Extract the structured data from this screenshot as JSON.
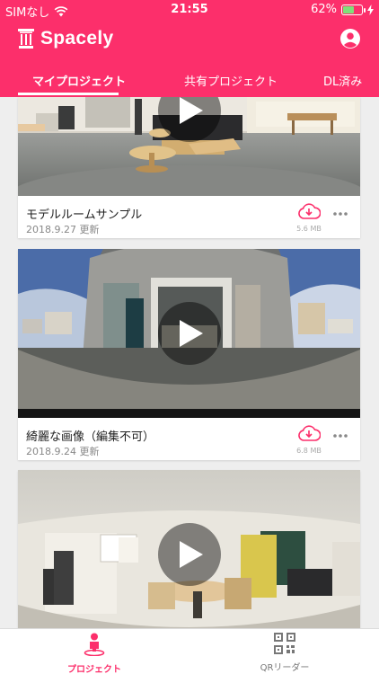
{
  "status_bar": {
    "carrier": "SIMなし",
    "time": "21:55",
    "battery": "62%",
    "battery_level": 0.62
  },
  "app": {
    "title": "Spacely"
  },
  "tabs": [
    {
      "label": "マイプロジェクト",
      "active": true
    },
    {
      "label": "共有プロジェクト",
      "active": false
    },
    {
      "label": "DL済み",
      "active": false
    }
  ],
  "projects": [
    {
      "title": "モデルルームサンプル",
      "date": "2018.9.27 更新",
      "size": "5.6 MB"
    },
    {
      "title": "綺麗な画像（編集不可）",
      "date": "2018.9.24 更新",
      "size": "6.8 MB"
    },
    {
      "title": "",
      "date": "",
      "size": ""
    }
  ],
  "bottom_nav": [
    {
      "label": "プロジェクト",
      "icon": "person-pin-icon",
      "active": true
    },
    {
      "label": "QRリーダー",
      "icon": "qr-code-icon",
      "active": false
    }
  ],
  "colors": {
    "accent": "#fc2f6b",
    "background": "#eeeeee",
    "battery": "#7fe07a"
  }
}
